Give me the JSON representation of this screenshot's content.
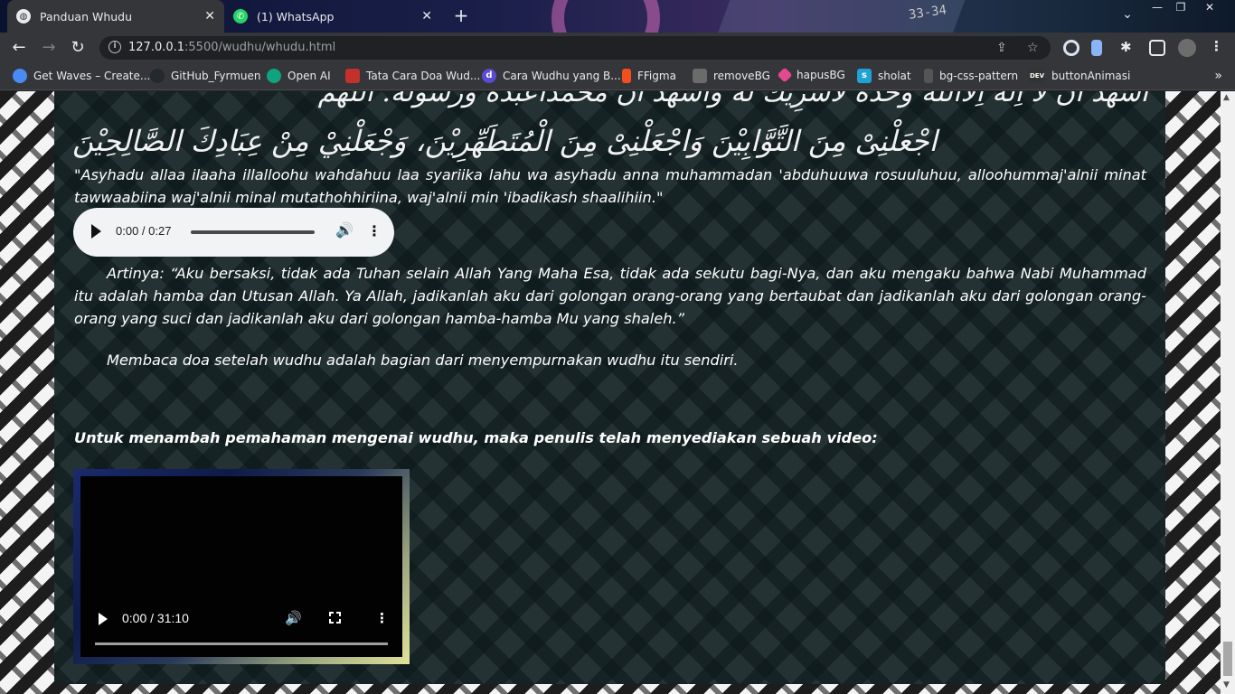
{
  "tabs": [
    {
      "title": "Panduan Whudu",
      "active": true
    },
    {
      "title": "(1) WhatsApp",
      "active": false
    }
  ],
  "tab_decoration_text": "33-34",
  "window_controls": {
    "minimize": "—",
    "restore": "❐",
    "close": "✕"
  },
  "toolbar": {
    "url_host": "127.0.0.1",
    "url_rest": ":5500/wudhu/whudu.html"
  },
  "bookmarks": [
    {
      "label": "Get Waves – Create...",
      "icon_color": "#4a8af4"
    },
    {
      "label": "GitHub_Fyrmuen",
      "icon_color": "#24292e"
    },
    {
      "label": "Open AI",
      "icon_color": "#10a37f"
    },
    {
      "label": "Tata Cara Doa Wud...",
      "icon_color": "#c4302b"
    },
    {
      "label": "Cara Wudhu yang B...",
      "icon_color": "#5b4bd4"
    },
    {
      "label": "FFigma",
      "icon_color": "#f24e1e"
    },
    {
      "label": "removeBG",
      "icon_color": "#6b6b6b"
    },
    {
      "label": "hapusBG",
      "icon_color": "#e24a8d"
    },
    {
      "label": "sholat",
      "icon_color": "#1fa3d6"
    },
    {
      "label": "bg-css-pattern",
      "icon_color": "#555555"
    },
    {
      "label": "buttonAnimasi",
      "icon_color": "#333333"
    }
  ],
  "content": {
    "arabic_line1": "اَشْهَدُ اَنْ لَا اِلَهَ اِلَّااللهُ وَحْدَهُ لَاشَرِيْكَ لَهُ وَاَشْهَدُ اَنَّ مُحَمَّدًاعَبْدُهُ وَرَسُوْلُهُ. اَللَّهُمَّ",
    "arabic_line2": "اجْعَلْنِىْ مِنَ التَّوَّابِيْنَ وَاجْعَلْنِىْ مِنَ الْمُتَطَهِّرِيْنَ، وَجْعَلْنِيْ مِنْ عِبَادِكَ الصَّالِحِيْنَ",
    "latin": "\"Asyhadu allaa ilaaha illalloohu wahdahuu laa syariika lahu wa asyhadu anna muhammadan 'abduhuuwa rosuuluhuu, alloohummaj'alnii minat tawwaabiina waj'alnii minal mutathohhiriina, waj'alnii min 'ibadikash shaalihiin.\"",
    "audio_time": "0:00 / 0:27",
    "artinya": "Artinya: “Aku bersaksi, tidak ada Tuhan selain Allah Yang Maha Esa, tidak ada sekutu bagi-Nya, dan aku mengaku bahwa Nabi Muhammad itu adalah hamba dan Utusan Allah. Ya Allah, jadikanlah aku dari golongan orang-orang yang bertaubat dan jadikanlah aku dari golongan orang-orang yang suci dan jadikanlah aku dari golongan hamba-hamba Mu yang shaleh.”",
    "membaca": "Membaca doa setelah wudhu adalah bagian dari menyempurnakan wudhu itu sendiri.",
    "video_heading": "Untuk menambah pemahaman mengenai wudhu, maka penulis telah menyediakan sebuah video:",
    "video_time": "0:00 / 31:10"
  }
}
